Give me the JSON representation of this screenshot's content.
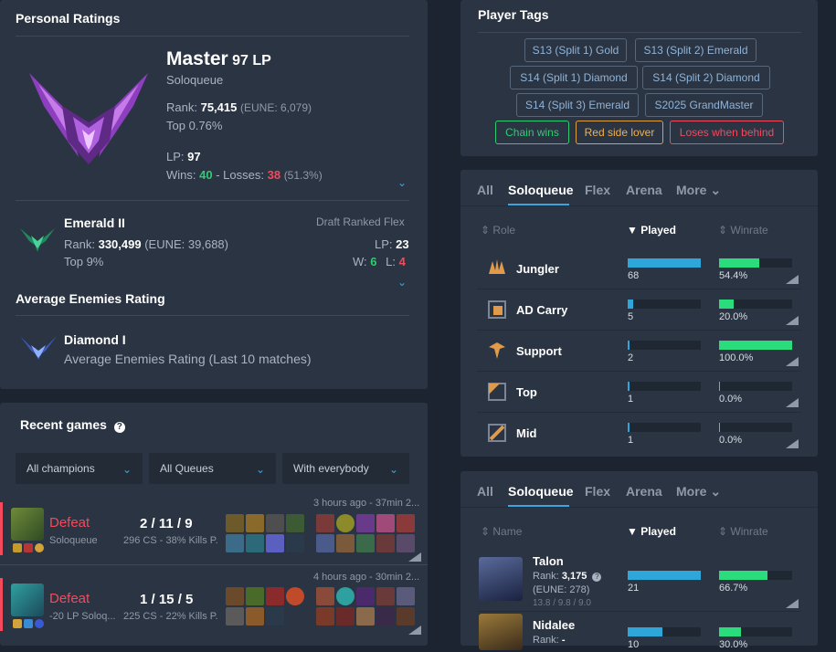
{
  "personal": {
    "title": "Personal Ratings",
    "tier": "Master",
    "lp_suffix": "97 LP",
    "queue": "Soloqueue",
    "rank_label": "Rank:",
    "rank_value": "75,415",
    "rank_region": "(EUNE: 6,079)",
    "top": "Top 0.76%",
    "lp_label": "LP:",
    "lp_value": "97",
    "wins_label": "Wins:",
    "wins": "40",
    "losses_label": "- Losses:",
    "losses": "38",
    "winrate": "(51.3%)"
  },
  "flex": {
    "tier": "Emerald II",
    "queue": "Draft Ranked Flex",
    "rank_label": "Rank:",
    "rank_value": "330,499",
    "rank_region": "(EUNE: 39,688)",
    "top": "Top 9%",
    "lp_label": "LP:",
    "lp_value": "23",
    "w_label": "W:",
    "w_value": "6",
    "l_label": "L:",
    "l_value": "4"
  },
  "enemies": {
    "title": "Average Enemies Rating",
    "tier": "Diamond I",
    "desc": "Average Enemies Rating (Last 10 matches)"
  },
  "recent": {
    "title": "Recent games",
    "filters": [
      "All champions",
      "All Queues",
      "With everybody"
    ],
    "games": [
      {
        "result": "Defeat",
        "queue": "Soloqueue",
        "kda": "2 / 11 / 9",
        "cs": "296 CS - 38% Kills P.",
        "time": "3 hours ago - 37min 2..."
      },
      {
        "result": "Defeat",
        "queue": "-20 LP Soloq...",
        "kda": "1 / 15 / 5",
        "cs": "225 CS - 22% Kills P.",
        "time": "4 hours ago - 30min 2..."
      }
    ]
  },
  "tags": {
    "title": "Player Tags",
    "items": [
      "S13 (Split 1) Gold",
      "S13 (Split 2) Emerald",
      "S14 (Split 1) Diamond",
      "S14 (Split 2) Diamond",
      "S14 (Split 3) Emerald",
      "S2025 GrandMaster",
      "Chain wins",
      "Red side lover",
      "Loses when behind"
    ]
  },
  "roles": {
    "tabs": [
      "All",
      "Soloqueue",
      "Flex",
      "Arena",
      "More"
    ],
    "col_role": "Role",
    "col_played": "Played",
    "col_winrate": "Winrate",
    "rows": [
      {
        "name": "Jungler",
        "played": "68",
        "played_frac": 1.0,
        "winrate": "54.4%",
        "win_frac": 0.544
      },
      {
        "name": "AD Carry",
        "played": "5",
        "played_frac": 0.074,
        "winrate": "20.0%",
        "win_frac": 0.2
      },
      {
        "name": "Support",
        "played": "2",
        "played_frac": 0.03,
        "winrate": "100.0%",
        "win_frac": 1.0
      },
      {
        "name": "Top",
        "played": "1",
        "played_frac": 0.015,
        "winrate": "0.0%",
        "win_frac": 0.0
      },
      {
        "name": "Mid",
        "played": "1",
        "played_frac": 0.015,
        "winrate": "0.0%",
        "win_frac": 0.0
      }
    ]
  },
  "champions": {
    "tabs": [
      "All",
      "Soloqueue",
      "Flex",
      "Arena",
      "More"
    ],
    "col_name": "Name",
    "col_played": "Played",
    "col_winrate": "Winrate",
    "rows": [
      {
        "name": "Talon",
        "rank_label": "Rank:",
        "rank": "3,175",
        "region": "(EUNE: 278)",
        "kda": "13.8 / 9.8 / 9.0",
        "played": "21",
        "played_frac": 1.0,
        "winrate": "66.7%",
        "win_frac": 0.667
      },
      {
        "name": "Nidalee",
        "rank_label": "Rank:",
        "rank": "-",
        "played": "10",
        "played_frac": 0.476,
        "winrate": "30.0%",
        "win_frac": 0.3
      }
    ]
  },
  "colors": {
    "accent": "#3aa6dc",
    "win": "#2ecc71",
    "loss": "#f44a5c",
    "bar_blue": "#2ea6d9",
    "bar_green": "#2bdc7d"
  }
}
